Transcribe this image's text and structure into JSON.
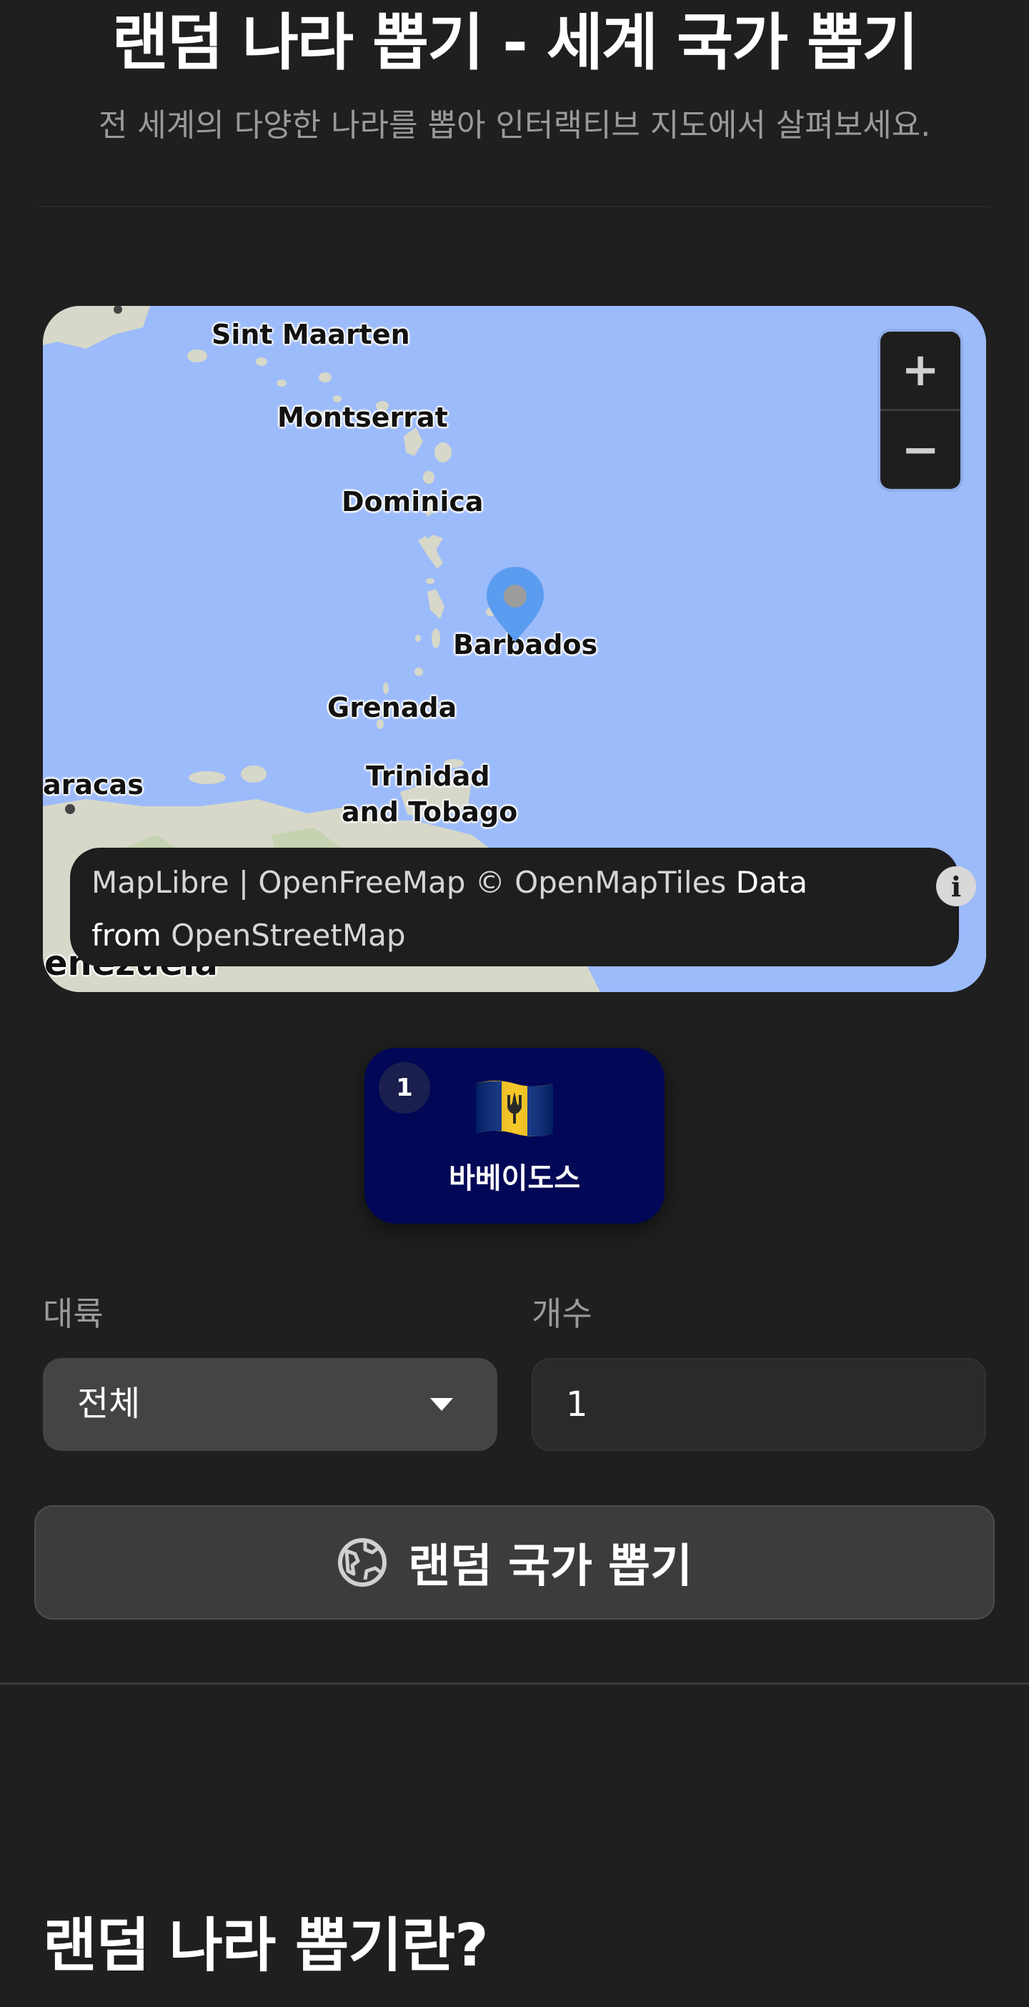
{
  "header": {
    "title": "랜덤 나라 뽑기 - 세계 국가 뽑기",
    "subtitle": "전 세계의 다양한 나라를 뽑아 인터랙티브 지도에서 살펴보세요."
  },
  "map": {
    "labels": {
      "sint_maarten": "Sint Maarten",
      "montserrat": "Montserrat",
      "dominica": "Dominica",
      "barbados": "Barbados",
      "grenada": "Grenada",
      "trinidad_line1": "Trinidad",
      "trinidad_line2": "and Tobago",
      "caracas": "aracas",
      "venezuela": "enezuela"
    },
    "zoom_in": "+",
    "zoom_out": "−",
    "attribution": {
      "maplibre": "MapLibre",
      "sep": " | ",
      "openfreemap": "OpenFreeMap",
      "copy": " © ",
      "openmaptiles": "OpenMapTiles",
      "data_from": " Data from ",
      "openstreetmap": "OpenStreetMap"
    },
    "info_icon": "i",
    "colors": {
      "water": "#9cbbfb",
      "land": "#d7d8c9",
      "marker": "#5a9cf0"
    }
  },
  "result": {
    "index": "1",
    "country_name": "바베이도스",
    "flag_icon": "barbados-flag"
  },
  "form": {
    "continent_label": "대륙",
    "continent_value": "전체",
    "count_label": "개수",
    "count_value": "1"
  },
  "draw_button": {
    "label": "랜덤 국가 뽑기",
    "icon": "globe-icon"
  },
  "about": {
    "title": "랜덤 나라 뽑기란?"
  }
}
